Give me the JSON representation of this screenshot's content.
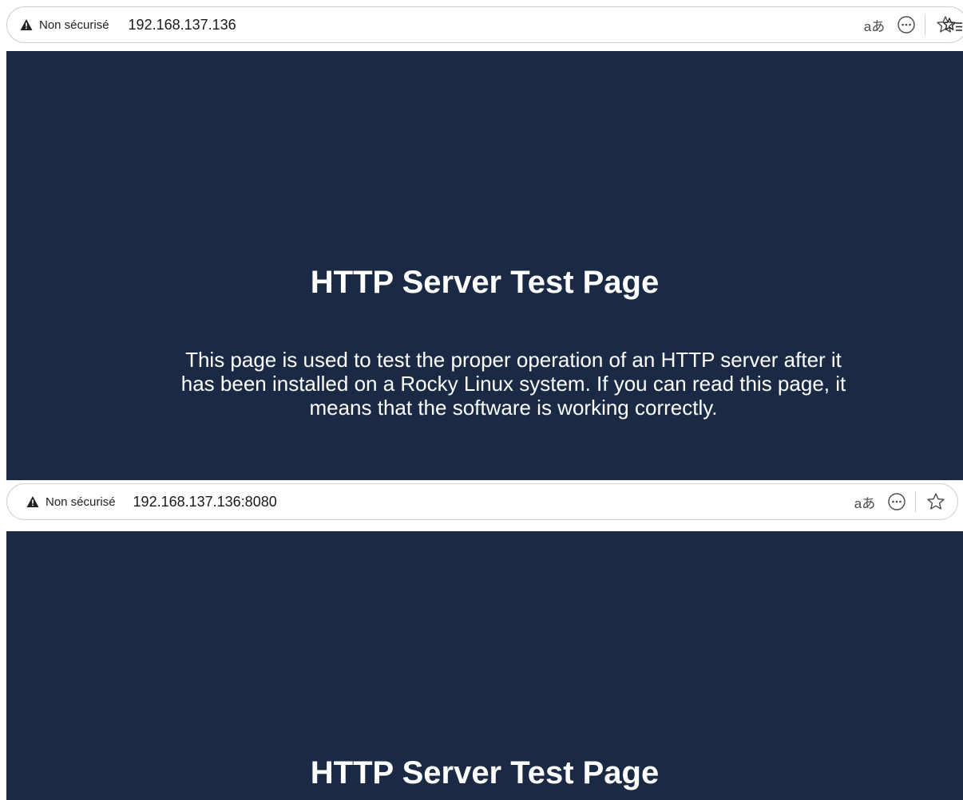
{
  "windows": [
    {
      "address_bar": {
        "security_label": "Non sécurisé",
        "url": "192.168.137.136",
        "translate_label": "aあ"
      },
      "page": {
        "title": "HTTP Server Test Page",
        "description": "This page is used to test the proper operation of an HTTP server after it has been installed on a Rocky Linux system. If you can read this page, it means that the software is working correctly."
      }
    },
    {
      "address_bar": {
        "security_label": "Non sécurisé",
        "url": "192.168.137.136:8080",
        "translate_label": "aあ"
      },
      "page": {
        "title": "HTTP Server Test Page"
      }
    }
  ],
  "colors": {
    "page_background": "#1b2a44",
    "page_text": "#ffffff"
  },
  "icons": [
    "warning-icon",
    "translate-icon",
    "more-options-icon",
    "favorite-star-icon",
    "favorites-list-icon"
  ]
}
